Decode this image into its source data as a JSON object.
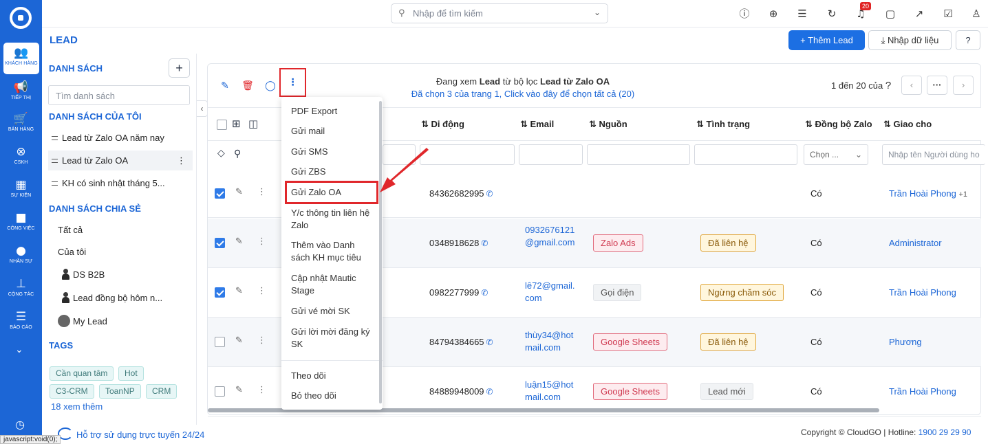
{
  "rail": {
    "items": [
      {
        "label": "KHÁCH HÀNG",
        "icon": "users-icon"
      },
      {
        "label": "TIẾP THỊ",
        "icon": "megaphone-icon"
      },
      {
        "label": "BÁN HÀNG",
        "icon": "cart-icon"
      },
      {
        "label": "CSKH",
        "icon": "lifebuoy-icon"
      },
      {
        "label": "SỰ KIỆN",
        "icon": "calendar-icon"
      },
      {
        "label": "CÔNG VIỆC",
        "icon": "briefcase-icon"
      },
      {
        "label": "NHÂN SỰ",
        "icon": "person-icon"
      },
      {
        "label": "CỘNG TÁC",
        "icon": "org-chart-icon"
      },
      {
        "label": "BÁO CÁO",
        "icon": "report-icon"
      }
    ]
  },
  "topbar": {
    "search_placeholder": "Nhập để tìm kiếm",
    "notification_count": "20"
  },
  "page": {
    "title": "LEAD",
    "add_button": "Thêm Lead",
    "import_button": "Nhập dữ liệu"
  },
  "left": {
    "lists_title": "DANH SÁCH",
    "list_search_placeholder": "Tìm danh sách",
    "my_lists_title": "DANH SÁCH CỦA TÔI",
    "my_lists": [
      "Lead từ Zalo OA năm nay",
      "Lead từ Zalo OA",
      "KH có sinh nhật tháng 5..."
    ],
    "shared_title": "DANH SÁCH CHIA SẺ",
    "shared": [
      "Tất cả",
      "Của tôi",
      "DS B2B",
      "Lead đồng bộ hôm n...",
      "My Lead"
    ],
    "tags_title": "TAGS",
    "tags": [
      "Cần quan tâm",
      "Hot",
      "C3-CRM",
      "ToanNP",
      "CRM"
    ],
    "more_tags": "18 xem thêm"
  },
  "toolbar": {
    "viewing_prefix": "Đang xem ",
    "viewing_module": "Lead",
    "viewing_mid": " từ bộ lọc ",
    "viewing_filter": "Lead từ Zalo OA",
    "selected_info": "Đã chọn 3 của trang 1, Click vào đây để chọn tất cả (20)",
    "paging": "1 đến 20 của"
  },
  "table": {
    "headers": {
      "mobile": "Di động",
      "email": "Email",
      "source": "Nguồn",
      "status": "Tình trạng",
      "zalo_sync": "Đồng bộ Zalo",
      "assigned": "Giao cho"
    },
    "filter_select": "Chọn ...",
    "filter_assignee_placeholder": "Nhập tên Người dùng ho",
    "rows": [
      {
        "checked": true,
        "mobile": "84362682995",
        "email": "",
        "source": "",
        "status": "",
        "zalo": "Có",
        "assigned": "Trần Hoài Phong",
        "extra": "+1"
      },
      {
        "checked": true,
        "mobile": "0348918628",
        "email": "0932676121@gmail.com",
        "source": "Zalo Ads",
        "status": "Đã liên hệ",
        "zalo": "Có",
        "assigned": "Administrator",
        "extra": ""
      },
      {
        "checked": true,
        "mobile": "0982277999",
        "email": "lê72@gmail.com",
        "source": "Gọi điện",
        "status": "Ngừng chăm sóc",
        "zalo": "Có",
        "assigned": "Trần Hoài Phong",
        "extra": ""
      },
      {
        "checked": false,
        "mobile": "84794384665",
        "email": "thùy34@hotmail.com",
        "source": "Google Sheets",
        "status": "Đã liên hệ",
        "zalo": "Có",
        "assigned": "Phương",
        "extra": ""
      },
      {
        "checked": false,
        "mobile": "84889948009",
        "email": "luận15@hotmail.com",
        "source": "Google Sheets",
        "status": "Lead mới",
        "zalo": "Có",
        "assigned": "Trần Hoài Phong",
        "extra": ""
      }
    ]
  },
  "dropdown": {
    "items": [
      "PDF Export",
      "Gửi mail",
      "Gửi SMS",
      "Gửi ZBS",
      "Gửi Zalo OA",
      "Y/c thông tin liên hệ Zalo",
      "Thêm vào Danh sách KH mục tiêu",
      "Cập nhật Mautic Stage",
      "Gửi vé mời SK",
      "Gửi lời mời đăng ký SK",
      "Theo dõi",
      "Bỏ theo dõi"
    ]
  },
  "footer": {
    "support": "Hỗ trợ sử dụng trực tuyến 24/24",
    "copyright": "Copyright © CloudGO",
    "hotline_label": "Hotline: ",
    "hotline": "1900 29 29 90",
    "status_url": "javascript:void(0);"
  },
  "colors": {
    "brand": "#1c66d6",
    "highlight": "#e0272b"
  }
}
